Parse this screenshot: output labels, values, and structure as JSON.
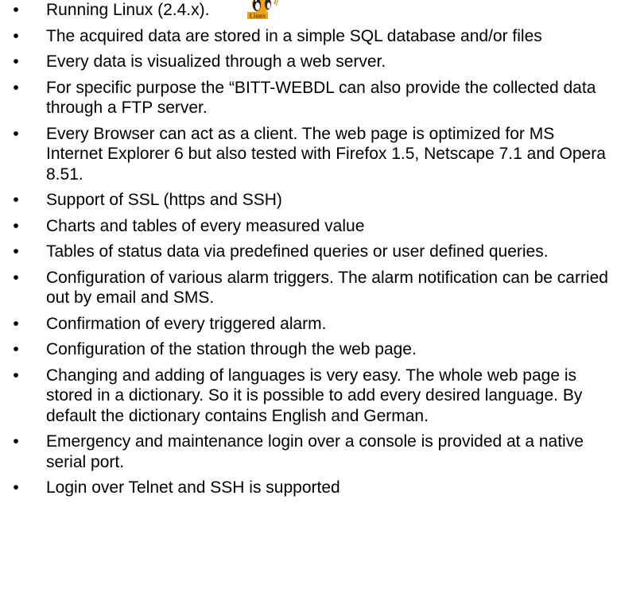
{
  "logo": {
    "icon": "linux-penguin-logo-icon",
    "text": "Linux",
    "accent": "#e8a317"
  },
  "bullet_glyph": "•",
  "items": [
    "Running Linux (2.4.x).",
    "The acquired data are stored in a simple SQL database and/or files",
    "Every data is visualized through a web server.",
    "For specific purpose the “BITT-WEBDL can also provide the collected data through a FTP server.",
    "Every Browser can act as a client. The web page is optimized for MS Internet Explorer 6 but also tested with Firefox 1.5, Netscape 7.1 and Opera 8.51.",
    "Support of SSL (https and SSH)",
    "Charts and tables of every measured value",
    "Tables of status data via predefined queries or user defined queries.",
    "Configuration of various alarm triggers. The alarm notification can be carried out by email and SMS.",
    "Confirmation of every triggered alarm.",
    "Configuration of the station through the web page.",
    "Changing and adding of languages is very easy. The whole web page is stored in a dictionary. So it is possible to add every desired language. By default the dictionary contains English and German.",
    "Emergency and maintenance login over a console is provided at a native serial port.",
    "Login over Telnet and SSH is supported"
  ]
}
